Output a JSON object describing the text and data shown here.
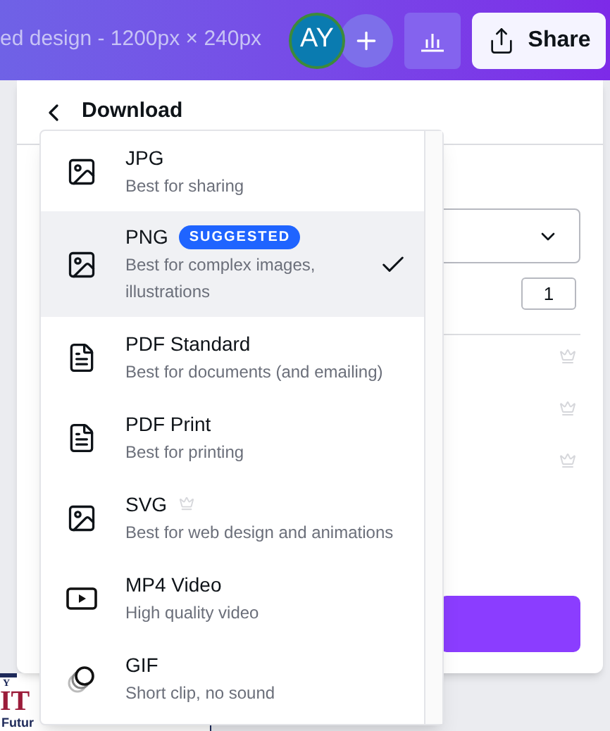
{
  "topbar": {
    "title": "ed design - 1200px × 240px",
    "avatar": "AY",
    "share": "Share"
  },
  "panel": {
    "title": "Download",
    "quantity": "1",
    "premium_rows": [
      {
        "premium": true
      },
      {
        "premium": true
      },
      {
        "premium": true
      }
    ]
  },
  "canvas": {
    "texts": [
      "Y",
      "IT",
      "Futur"
    ]
  },
  "menu": {
    "items": [
      {
        "kind": "image",
        "name": "JPG",
        "description": "Best for sharing",
        "selected": false,
        "premium": false
      },
      {
        "kind": "image",
        "name": "PNG",
        "badge": "SUGGESTED",
        "description": "Best for complex images, illustrations",
        "selected": true,
        "premium": false
      },
      {
        "kind": "document",
        "name": "PDF Standard",
        "description": "Best for documents (and emailing)",
        "selected": false,
        "premium": false
      },
      {
        "kind": "document",
        "name": "PDF Print",
        "description": "Best for printing",
        "selected": false,
        "premium": false
      },
      {
        "kind": "image",
        "name": "SVG",
        "description": "Best for web design and animations",
        "selected": false,
        "premium": true
      },
      {
        "kind": "video",
        "name": "MP4 Video",
        "description": "High quality video",
        "selected": false,
        "premium": false
      },
      {
        "kind": "gif",
        "name": "GIF",
        "description": "Short clip, no sound",
        "selected": false,
        "premium": false
      }
    ]
  }
}
